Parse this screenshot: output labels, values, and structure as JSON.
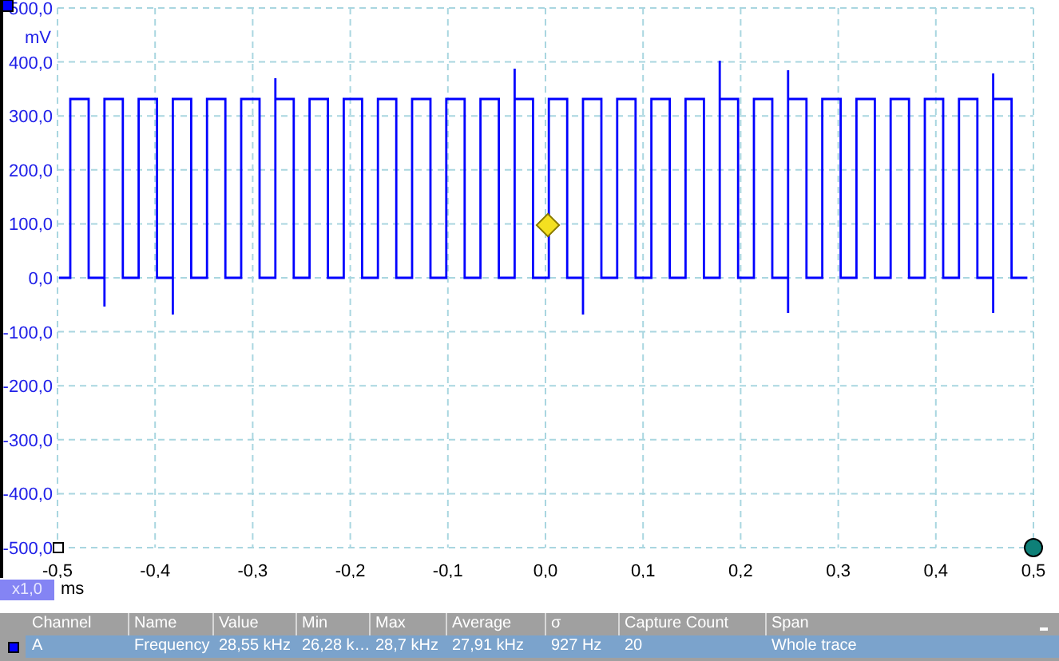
{
  "plot": {
    "y_unit": "mV",
    "y_ticks": [
      "500,0",
      "400,0",
      "300,0",
      "200,0",
      "100,0",
      "0,0",
      "-100,0",
      "-200,0",
      "-300,0",
      "-400,0",
      "-500,0"
    ],
    "x_ticks": [
      "-0,5",
      "-0,4",
      "-0,3",
      "-0,2",
      "-0,1",
      "0,0",
      "0,1",
      "0,2",
      "0,3",
      "0,4",
      "0,5"
    ],
    "x_unit": "ms",
    "zoom": "x1,0"
  },
  "measurements": {
    "columns": [
      "Channel",
      "Name",
      "Value",
      "Min",
      "Max",
      "Average",
      "σ",
      "Capture Count",
      "Span"
    ],
    "rows": [
      {
        "color": "#0000ff",
        "selected": true,
        "cells": [
          "A",
          "Frequency",
          "28,55 kHz",
          "26,28 k…",
          "28,7 kHz",
          "27,91 kHz",
          "927 Hz",
          "20",
          "Whole trace"
        ]
      }
    ]
  }
}
